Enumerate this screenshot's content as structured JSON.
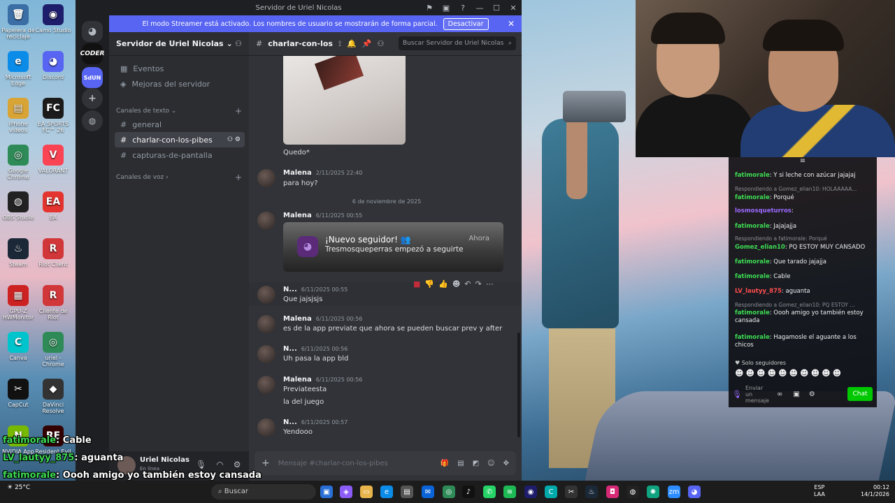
{
  "desktop_icons": [
    {
      "label": "Papelera de reciclaje",
      "glyph": "🗑",
      "color": "#3a6ea5"
    },
    {
      "label": "Camo Studio",
      "glyph": "◉",
      "color": "#1d1d6b"
    },
    {
      "label": "Microsoft Edge",
      "glyph": "e",
      "color": "#0c8ce9"
    },
    {
      "label": "Discord",
      "glyph": "◕",
      "color": "#5865f2"
    },
    {
      "label": "iPhone videos",
      "glyph": "▤",
      "color": "#d8a436"
    },
    {
      "label": "EA SPORTS FC™ 26",
      "glyph": "FC",
      "color": "#1b1b1b"
    },
    {
      "label": "Google Chrome",
      "glyph": "◎",
      "color": "#2e8b57"
    },
    {
      "label": "VALORANT",
      "glyph": "V",
      "color": "#fa4454"
    },
    {
      "label": "OBS Studio",
      "glyph": "◍",
      "color": "#222"
    },
    {
      "label": "EA",
      "glyph": "EA",
      "color": "#e4342f"
    },
    {
      "label": "Steam",
      "glyph": "♨",
      "color": "#1b2838"
    },
    {
      "label": "Riot Client",
      "glyph": "R",
      "color": "#d13639"
    },
    {
      "label": "GPU-Z HWMonitor",
      "glyph": "▦",
      "color": "#c22"
    },
    {
      "label": "Cliente de Riot",
      "glyph": "R",
      "color": "#d13639"
    },
    {
      "label": "Canva",
      "glyph": "C",
      "color": "#00c4cc"
    },
    {
      "label": "uriel - Chrome",
      "glyph": "◎",
      "color": "#2e8b57"
    },
    {
      "label": "CapCut",
      "glyph": "✂",
      "color": "#111"
    },
    {
      "label": "DaVinci Resolve",
      "glyph": "◆",
      "color": "#333"
    },
    {
      "label": "NVIDIA App",
      "glyph": "N",
      "color": "#76b900"
    },
    {
      "label": "Resident Evil",
      "glyph": "RE",
      "color": "#300"
    }
  ],
  "discord": {
    "window_title": "Servidor de Uriel Nicolas",
    "banner": {
      "text": "El modo Streamer está activado. Los nombres de usuario se mostrarán de forma parcial.",
      "button": "Desactivar"
    },
    "rail": [
      "CODER",
      "SdUN"
    ],
    "server_name": "Servidor de Uriel Nicolas",
    "nav": [
      "Eventos",
      "Mejoras del servidor"
    ],
    "text_category": "Canales de texto",
    "voice_category": "Canales de voz",
    "channels": [
      "general",
      "charlar-con-los-pibes",
      "capturas-de-pantalla"
    ],
    "active_channel_short": "charlar-con-los",
    "search_placeholder": "Buscar Servidor de Uriel Nicolas",
    "user_name": "Uriel Nicolas",
    "user_status": "En línea",
    "composer_placeholder": "Mensaje #charlar-con-los-pibes"
  },
  "messages": {
    "first_text": "Quedo*",
    "m1": {
      "author": "Malena",
      "time": "2/11/2025 22:40",
      "text": "para hoy?"
    },
    "date_divider": "6 de noviembre de 2025",
    "m2": {
      "author": "Malena",
      "time": "6/11/2025 00:55"
    },
    "notification": {
      "title": "¡Nuevo seguidor! 👥",
      "body": "Tresmosqueperras empezó a seguirte",
      "when": "Ahora"
    },
    "m3": {
      "author": "N...",
      "time": "6/11/2025 00:55",
      "text": "Que jajsjsjs"
    },
    "m4": {
      "author": "Malena",
      "time": "6/11/2025 00:56",
      "text": "es de la app previate que ahora se pueden buscar prev y after"
    },
    "m5": {
      "author": "N...",
      "time": "6/11/2025 00:56",
      "text": "Uh pasa la app bld"
    },
    "m6": {
      "author": "Malena",
      "time": "6/11/2025 00:56",
      "text1": "Previateesta",
      "text2": "la del juego"
    },
    "m7": {
      "author": "N...",
      "time": "6/11/2025 00:57",
      "text": "Yendooo"
    }
  },
  "stream_chat": {
    "lines": [
      {
        "user": "fatimorale",
        "color": "#ffffff",
        "text": "Y si leche con azúcar jajajaj"
      },
      {
        "reply": "Respondiendo a Gomez_elian10: HOLAAAAA..."
      },
      {
        "user": "fatimorale",
        "color": "#ffffff",
        "text": "Porqué"
      },
      {
        "user": "losmosqueturros",
        "color": "#9b6bff",
        "text": ""
      },
      {
        "user": "fatimorale",
        "color": "#ffffff",
        "text": "Jajajajja"
      },
      {
        "reply": "Respondiendo a fatimorale: Porqué"
      },
      {
        "user": "Gomez_elian10",
        "color": "#3ddc53",
        "text": "PQ ESTOY MUY CANSADO"
      },
      {
        "user": "fatimorale",
        "color": "#ffffff",
        "text": "Que tarado jajajja"
      },
      {
        "user": "fatimorale",
        "color": "#ffffff",
        "text": "Cable"
      },
      {
        "user": "LV_lautyy_875",
        "color": "#ff4d4d",
        "text": "aguanta"
      },
      {
        "reply": "Respondiendo a Gomez_elian10: PQ ESTOY ..."
      },
      {
        "user": "fatimorale",
        "color": "#ffffff",
        "text": "Oooh amigo yo también estoy cansada"
      },
      {
        "user": "fatimorale",
        "color": "#ffffff",
        "text": "Hagamosle el aguante a los chicos"
      }
    ],
    "followers_only": "Solo seguidores",
    "input_placeholder": "Enviar un mensaje",
    "chat_button": "Chat"
  },
  "overlay_chat": [
    {
      "user": "fatimorale",
      "text": "Cable"
    },
    {
      "user": "LV_lautyy_875",
      "text": "aguanta"
    },
    {
      "user": "fatimorale",
      "text": "Oooh amigo yo también estoy cansada"
    },
    {
      "user": "fatimorale",
      "text": "Hagamosle el aguante a los chicos"
    }
  ],
  "taskbar": {
    "temperature": "25°C",
    "search": "Buscar",
    "lang": "ESP",
    "lang2": "LAA",
    "time": "00:12",
    "date": "14/1/2026"
  }
}
